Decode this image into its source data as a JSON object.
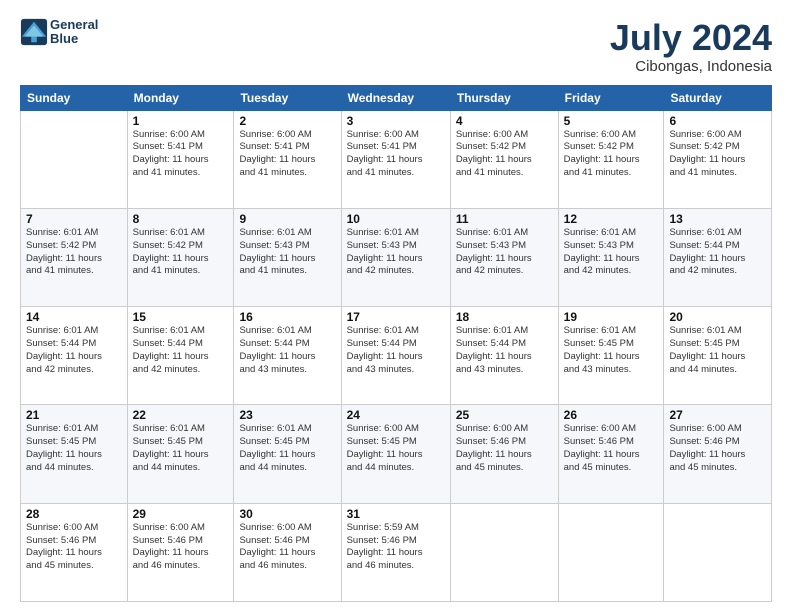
{
  "header": {
    "logo_line1": "General",
    "logo_line2": "Blue",
    "month": "July 2024",
    "location": "Cibongas, Indonesia"
  },
  "days_of_week": [
    "Sunday",
    "Monday",
    "Tuesday",
    "Wednesday",
    "Thursday",
    "Friday",
    "Saturday"
  ],
  "weeks": [
    [
      {
        "day": "",
        "info": ""
      },
      {
        "day": "1",
        "info": "Sunrise: 6:00 AM\nSunset: 5:41 PM\nDaylight: 11 hours\nand 41 minutes."
      },
      {
        "day": "2",
        "info": "Sunrise: 6:00 AM\nSunset: 5:41 PM\nDaylight: 11 hours\nand 41 minutes."
      },
      {
        "day": "3",
        "info": "Sunrise: 6:00 AM\nSunset: 5:41 PM\nDaylight: 11 hours\nand 41 minutes."
      },
      {
        "day": "4",
        "info": "Sunrise: 6:00 AM\nSunset: 5:42 PM\nDaylight: 11 hours\nand 41 minutes."
      },
      {
        "day": "5",
        "info": "Sunrise: 6:00 AM\nSunset: 5:42 PM\nDaylight: 11 hours\nand 41 minutes."
      },
      {
        "day": "6",
        "info": "Sunrise: 6:00 AM\nSunset: 5:42 PM\nDaylight: 11 hours\nand 41 minutes."
      }
    ],
    [
      {
        "day": "7",
        "info": "Sunrise: 6:01 AM\nSunset: 5:42 PM\nDaylight: 11 hours\nand 41 minutes."
      },
      {
        "day": "8",
        "info": "Sunrise: 6:01 AM\nSunset: 5:42 PM\nDaylight: 11 hours\nand 41 minutes."
      },
      {
        "day": "9",
        "info": "Sunrise: 6:01 AM\nSunset: 5:43 PM\nDaylight: 11 hours\nand 41 minutes."
      },
      {
        "day": "10",
        "info": "Sunrise: 6:01 AM\nSunset: 5:43 PM\nDaylight: 11 hours\nand 42 minutes."
      },
      {
        "day": "11",
        "info": "Sunrise: 6:01 AM\nSunset: 5:43 PM\nDaylight: 11 hours\nand 42 minutes."
      },
      {
        "day": "12",
        "info": "Sunrise: 6:01 AM\nSunset: 5:43 PM\nDaylight: 11 hours\nand 42 minutes."
      },
      {
        "day": "13",
        "info": "Sunrise: 6:01 AM\nSunset: 5:44 PM\nDaylight: 11 hours\nand 42 minutes."
      }
    ],
    [
      {
        "day": "14",
        "info": "Sunrise: 6:01 AM\nSunset: 5:44 PM\nDaylight: 11 hours\nand 42 minutes."
      },
      {
        "day": "15",
        "info": "Sunrise: 6:01 AM\nSunset: 5:44 PM\nDaylight: 11 hours\nand 42 minutes."
      },
      {
        "day": "16",
        "info": "Sunrise: 6:01 AM\nSunset: 5:44 PM\nDaylight: 11 hours\nand 43 minutes."
      },
      {
        "day": "17",
        "info": "Sunrise: 6:01 AM\nSunset: 5:44 PM\nDaylight: 11 hours\nand 43 minutes."
      },
      {
        "day": "18",
        "info": "Sunrise: 6:01 AM\nSunset: 5:44 PM\nDaylight: 11 hours\nand 43 minutes."
      },
      {
        "day": "19",
        "info": "Sunrise: 6:01 AM\nSunset: 5:45 PM\nDaylight: 11 hours\nand 43 minutes."
      },
      {
        "day": "20",
        "info": "Sunrise: 6:01 AM\nSunset: 5:45 PM\nDaylight: 11 hours\nand 44 minutes."
      }
    ],
    [
      {
        "day": "21",
        "info": "Sunrise: 6:01 AM\nSunset: 5:45 PM\nDaylight: 11 hours\nand 44 minutes."
      },
      {
        "day": "22",
        "info": "Sunrise: 6:01 AM\nSunset: 5:45 PM\nDaylight: 11 hours\nand 44 minutes."
      },
      {
        "day": "23",
        "info": "Sunrise: 6:01 AM\nSunset: 5:45 PM\nDaylight: 11 hours\nand 44 minutes."
      },
      {
        "day": "24",
        "info": "Sunrise: 6:00 AM\nSunset: 5:45 PM\nDaylight: 11 hours\nand 44 minutes."
      },
      {
        "day": "25",
        "info": "Sunrise: 6:00 AM\nSunset: 5:46 PM\nDaylight: 11 hours\nand 45 minutes."
      },
      {
        "day": "26",
        "info": "Sunrise: 6:00 AM\nSunset: 5:46 PM\nDaylight: 11 hours\nand 45 minutes."
      },
      {
        "day": "27",
        "info": "Sunrise: 6:00 AM\nSunset: 5:46 PM\nDaylight: 11 hours\nand 45 minutes."
      }
    ],
    [
      {
        "day": "28",
        "info": "Sunrise: 6:00 AM\nSunset: 5:46 PM\nDaylight: 11 hours\nand 45 minutes."
      },
      {
        "day": "29",
        "info": "Sunrise: 6:00 AM\nSunset: 5:46 PM\nDaylight: 11 hours\nand 46 minutes."
      },
      {
        "day": "30",
        "info": "Sunrise: 6:00 AM\nSunset: 5:46 PM\nDaylight: 11 hours\nand 46 minutes."
      },
      {
        "day": "31",
        "info": "Sunrise: 5:59 AM\nSunset: 5:46 PM\nDaylight: 11 hours\nand 46 minutes."
      },
      {
        "day": "",
        "info": ""
      },
      {
        "day": "",
        "info": ""
      },
      {
        "day": "",
        "info": ""
      }
    ]
  ]
}
